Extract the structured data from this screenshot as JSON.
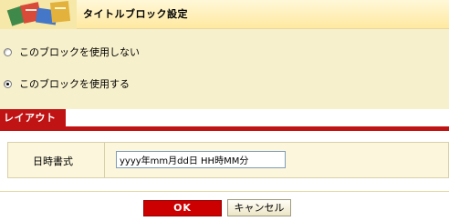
{
  "header": {
    "title": "タイトルブロック設定",
    "icon": "books-icon"
  },
  "options": [
    {
      "label": "このブロックを使用しない",
      "checked": false
    },
    {
      "label": "このブロックを使用する",
      "checked": true
    }
  ],
  "tab": {
    "label": "レイアウト"
  },
  "field": {
    "label": "日時書式",
    "value": "yyyy年mm月dd日 HH時MM分"
  },
  "buttons": {
    "ok_label": "OK",
    "cancel_label": "キャンセル"
  },
  "colors": {
    "accent_red": "#c01414",
    "header_bg": "#ffe9a0",
    "panel_bg": "#f7f0cc"
  }
}
